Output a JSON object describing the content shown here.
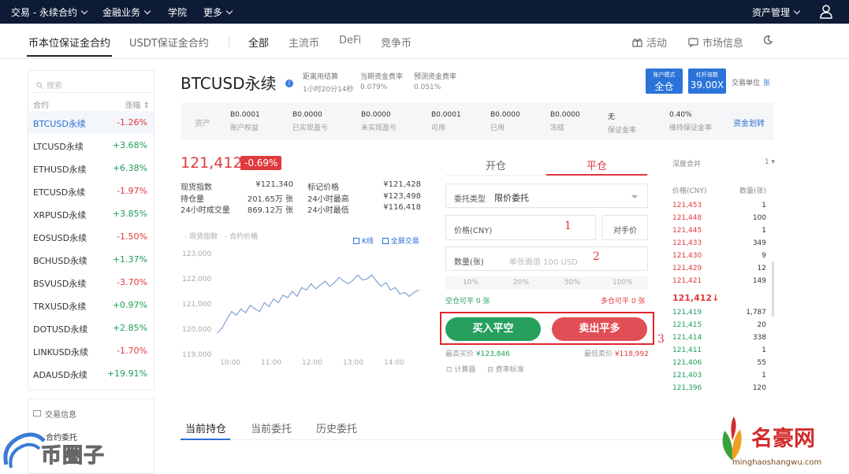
{
  "topnav": {
    "items": [
      "交易 - 永续合约",
      "金融业务",
      "学院",
      "更多"
    ],
    "right": "资产管理"
  },
  "subnav": {
    "tabs": [
      "币本位保证金合约",
      "USDT保证金合约"
    ],
    "categories": [
      "全部",
      "主流币",
      "DeFi",
      "竞争币"
    ],
    "activity": "活动",
    "market_info": "市场信息"
  },
  "sidebar": {
    "search_placeholder": "搜索",
    "col_contract": "合约",
    "col_change": "涨幅",
    "rows": [
      {
        "name": "BTCUSD永续",
        "change": "-1.26%",
        "dir": "down",
        "active": true
      },
      {
        "name": "LTCUSD永续",
        "change": "+3.68%",
        "dir": "up"
      },
      {
        "name": "ETHUSD永续",
        "change": "+6.38%",
        "dir": "up"
      },
      {
        "name": "ETCUSD永续",
        "change": "-1.97%",
        "dir": "down"
      },
      {
        "name": "XRPUSD永续",
        "change": "+3.85%",
        "dir": "up"
      },
      {
        "name": "EOSUSD永续",
        "change": "-1.50%",
        "dir": "down"
      },
      {
        "name": "BCHUSD永续",
        "change": "+1.37%",
        "dir": "up"
      },
      {
        "name": "BSVUSD永续",
        "change": "-3.70%",
        "dir": "down"
      },
      {
        "name": "TRXUSD永续",
        "change": "+0.97%",
        "dir": "up"
      },
      {
        "name": "DOTUSD永续",
        "change": "+2.85%",
        "dir": "up"
      },
      {
        "name": "LINKUSD永续",
        "change": "-1.70%",
        "dir": "down"
      },
      {
        "name": "ADAUSD永续",
        "change": "+19.91%",
        "dir": "up"
      }
    ],
    "section2_title": "交易信息",
    "section2_item": "合约委托"
  },
  "header": {
    "title": "BTCUSD永续",
    "settle_label": "距离用结算",
    "settle_value": "1小时20分14秒",
    "fund_rate_label": "当期资金费率",
    "fund_rate_value": "0.079%",
    "pred_rate_label": "预测资金费率",
    "pred_rate_value": "0.051%",
    "mode_small": "账户模式",
    "mode_big": "全仓",
    "lev_small": "杠杆倍数",
    "lev_big": "39.00X",
    "unit_label": "交易单位",
    "unit_value": "张"
  },
  "assets": {
    "label": "资产",
    "cells": [
      {
        "value": "B0.0001",
        "label": "账户权益"
      },
      {
        "value": "B0.0000",
        "label": "已实现盈亏"
      },
      {
        "value": "B0.0000",
        "label": "未实现盈亏"
      },
      {
        "value": "B0.0001",
        "label": "可用"
      },
      {
        "value": "B0.0000",
        "label": "已用"
      },
      {
        "value": "B0.0000",
        "label": "冻结"
      },
      {
        "value": "无",
        "label": "保证金率"
      },
      {
        "value": "0.40%",
        "label": "维持保证金率"
      }
    ],
    "transfer": "资金划转"
  },
  "ticker": {
    "price": "121,412",
    "change": "-0.69%",
    "stats_left": [
      {
        "label": "现货指数",
        "value": "¥121,340"
      },
      {
        "label": "持仓量",
        "value": "201.65万 张"
      },
      {
        "label": "24小时成交量",
        "value": "869.12万 张"
      }
    ],
    "stats_right": [
      {
        "label": "标记价格",
        "value": "¥121,428"
      },
      {
        "label": "24小时最高",
        "value": "¥123,498"
      },
      {
        "label": "24小时最低",
        "value": "¥116,418"
      }
    ]
  },
  "chart": {
    "legend1": "现货指数",
    "legend2": "合约价格",
    "kline": "K线",
    "fullscreen": "全屏交易",
    "line_color": "#8aa8d8"
  },
  "chart_data": {
    "type": "line",
    "x": [
      "10:00",
      "11:00",
      "12:00",
      "13:00",
      "14:00"
    ],
    "yticks": [
      "123,000",
      "122,000",
      "121,000",
      "120,000",
      "119,000"
    ],
    "ylim": [
      119000,
      123000
    ],
    "series": [
      {
        "values": [
          119850,
          120050,
          120400,
          120700,
          120550,
          120800,
          120650,
          120950,
          120800,
          120700,
          121050,
          120900,
          121200,
          121050,
          121350,
          121250,
          121500,
          121300,
          121650,
          121550,
          121800,
          121600,
          121750,
          121900,
          121700,
          121850,
          122050,
          121900,
          121800,
          121950,
          122150,
          121950,
          122000,
          122150,
          121900,
          121700,
          121850,
          121550,
          121650,
          121400,
          121450,
          121300,
          121450,
          121550
        ]
      }
    ],
    "grid": false
  },
  "order": {
    "tab_open": "开仓",
    "tab_close": "平仓",
    "type_label": "委托类型",
    "type_value": "限价委托",
    "price_label": "价格(CNY)",
    "counter_price": "对手价",
    "qty_label": "数量(张)",
    "qty_placeholder": "单张面值 100 USD",
    "pcts": [
      "10%",
      "20%",
      "50%",
      "100%"
    ],
    "long_avail": "空仓可平 0 张",
    "short_avail": "多仓可平 0 张",
    "buy": "买入平空",
    "sell": "卖出平多",
    "max_buy_label": "最高买价",
    "max_buy_value": "¥123,846",
    "min_sell_label": "最低卖价",
    "min_sell_value": "¥118,992",
    "calc": "计算器",
    "fee": "费率标准",
    "anno1": "1",
    "anno2": "2",
    "anno3": "3"
  },
  "depth": {
    "merge_label": "深度合并",
    "merge_value": "1",
    "col_price": "价格(CNY)",
    "col_qty": "数量(张)",
    "asks": [
      {
        "p": "121,453",
        "q": "1"
      },
      {
        "p": "121,448",
        "q": "100"
      },
      {
        "p": "121,445",
        "q": "1"
      },
      {
        "p": "121,433",
        "q": "349"
      },
      {
        "p": "121,430",
        "q": "9"
      },
      {
        "p": "121,429",
        "q": "12"
      },
      {
        "p": "121,421",
        "q": "149"
      }
    ],
    "mid": "121,412",
    "bids": [
      {
        "p": "121,419",
        "q": "1,787"
      },
      {
        "p": "121,415",
        "q": "20"
      },
      {
        "p": "121,414",
        "q": "338"
      },
      {
        "p": "121,411",
        "q": "1"
      },
      {
        "p": "121,406",
        "q": "55"
      },
      {
        "p": "121,403",
        "q": "1"
      },
      {
        "p": "121,396",
        "q": "120"
      }
    ]
  },
  "bottom_tabs": [
    "当前持仓",
    "当前委托",
    "历史委托"
  ],
  "watermarks": {
    "left": "币圈子",
    "right_big": "名豪网",
    "right_small": "minghaoshangwu.com"
  }
}
